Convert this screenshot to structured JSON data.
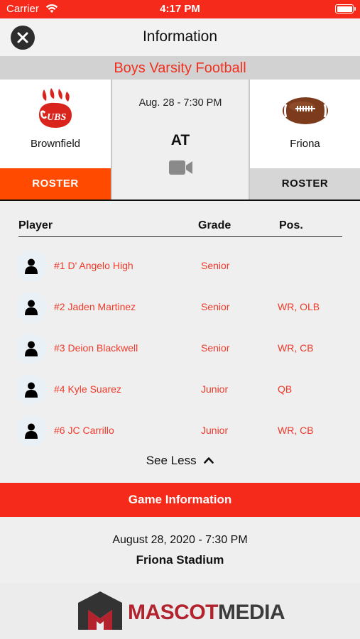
{
  "status_bar": {
    "carrier": "Carrier",
    "time": "4:17 PM"
  },
  "nav": {
    "title": "Information",
    "close_icon": "close-icon"
  },
  "sport": {
    "title": "Boys Varsity Football"
  },
  "matchup": {
    "home": {
      "name": "Brownfield",
      "roster_label": "ROSTER",
      "logo": "cubs-paw-logo"
    },
    "away": {
      "name": "Friona",
      "roster_label": "ROSTER",
      "logo": "football-logo"
    },
    "datetime": "Aug. 28 - 7:30 PM",
    "vs": "AT",
    "video_icon": "video-camera-icon"
  },
  "roster": {
    "headers": {
      "player": "Player",
      "grade": "Grade",
      "pos": "Pos."
    },
    "players": [
      {
        "name": "#1 D' Angelo High",
        "grade": "Senior",
        "pos": ""
      },
      {
        "name": "#2 Jaden Martinez",
        "grade": "Senior",
        "pos": "WR, OLB"
      },
      {
        "name": "#3 Deion Blackwell",
        "grade": "Senior",
        "pos": "WR, CB"
      },
      {
        "name": "#4 Kyle Suarez",
        "grade": "Junior",
        "pos": "QB"
      },
      {
        "name": "#6 JC Carrillo",
        "grade": "Junior",
        "pos": "WR, CB"
      }
    ],
    "see_less": "See Less"
  },
  "game_info": {
    "title": "Game Information",
    "date": "August 28, 2020 - 7:30 PM",
    "venue": "Friona Stadium"
  },
  "footer": {
    "brand_mascot": "MASCOT",
    "brand_media": "MEDIA"
  },
  "colors": {
    "accent": "#f52a1a",
    "roster_home": "#ff4a00",
    "text_red": "#f03a2a",
    "brand": "#b2232e"
  }
}
